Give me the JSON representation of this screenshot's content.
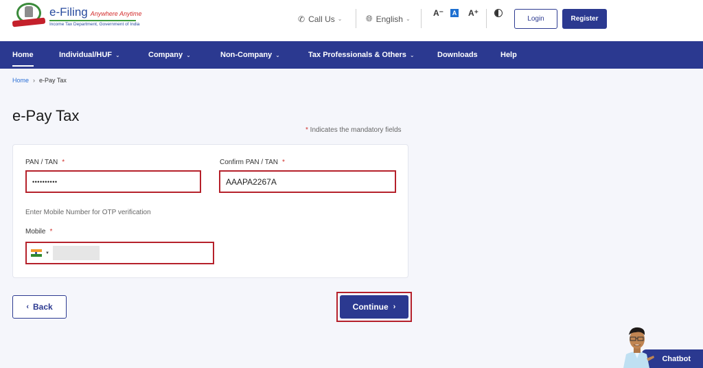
{
  "header": {
    "logo_title": "e-Filing",
    "logo_tagline": "Anywhere Anytime",
    "logo_subtitle": "Income Tax Department, Government of India",
    "call_us": "Call Us",
    "language": "English",
    "font_decrease": "A⁻",
    "font_default": "A",
    "font_increase": "A⁺",
    "login": "Login",
    "register": "Register"
  },
  "nav": {
    "items": [
      {
        "label": "Home",
        "dropdown": false,
        "active": true
      },
      {
        "label": "Individual/HUF",
        "dropdown": true
      },
      {
        "label": "Company",
        "dropdown": true
      },
      {
        "label": "Non-Company",
        "dropdown": true
      },
      {
        "label": "Tax Professionals & Others",
        "dropdown": true
      },
      {
        "label": "Downloads",
        "dropdown": false
      },
      {
        "label": "Help",
        "dropdown": false
      }
    ],
    "chevron": "ˇ"
  },
  "breadcrumb": {
    "home": "Home",
    "separator": "›",
    "current": "e-Pay Tax"
  },
  "page": {
    "title": "e-Pay Tax",
    "mandatory_star": "*",
    "mandatory_note": " Indicates the mandatory fields"
  },
  "form": {
    "pan_label": "PAN / TAN",
    "pan_value": "••••••••••",
    "confirm_pan_label": "Confirm PAN / TAN",
    "confirm_pan_value": "AAAPA2267A",
    "otp_hint": "Enter Mobile Number for OTP verification",
    "mobile_label": "Mobile",
    "required_star": "*",
    "country": "India"
  },
  "actions": {
    "back": "Back",
    "continue": "Continue",
    "back_chevron": "‹",
    "continue_chevron": "›"
  },
  "chatbot": {
    "label": "Chatbot"
  },
  "colors": {
    "primary": "#2b3990",
    "error_border": "#b5202a",
    "link": "#2a6fd6"
  }
}
